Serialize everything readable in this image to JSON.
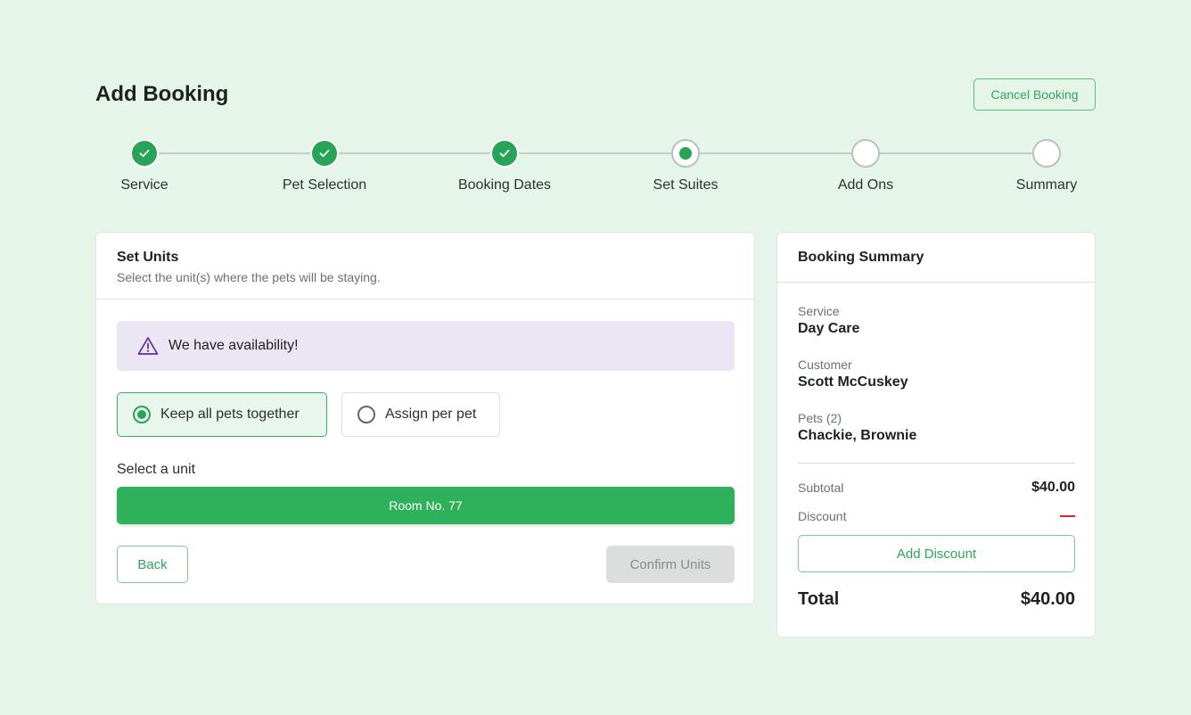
{
  "header": {
    "title": "Add Booking",
    "cancel_label": "Cancel Booking"
  },
  "stepper": {
    "steps": [
      {
        "label": "Service",
        "state": "done"
      },
      {
        "label": "Pet Selection",
        "state": "done"
      },
      {
        "label": "Booking Dates",
        "state": "done"
      },
      {
        "label": "Set Suites",
        "state": "current"
      },
      {
        "label": "Add Ons",
        "state": "todo"
      },
      {
        "label": "Summary",
        "state": "todo"
      }
    ]
  },
  "units_card": {
    "title": "Set Units",
    "subtitle": "Select the unit(s) where the pets will be staying.",
    "alert_text": "We have availability!",
    "options": [
      {
        "label": "Keep all pets together",
        "selected": true
      },
      {
        "label": "Assign per pet",
        "selected": false
      }
    ],
    "select_label": "Select a unit",
    "selected_unit": "Room No. 77",
    "back_label": "Back",
    "confirm_label": "Confirm Units"
  },
  "summary_card": {
    "title": "Booking Summary",
    "service_label": "Service",
    "service_value": "Day Care",
    "customer_label": "Customer",
    "customer_value": "Scott McCuskey",
    "pets_label": "Pets (2)",
    "pets_value": "Chackie, Brownie",
    "subtotal_label": "Subtotal",
    "subtotal_value": "$40.00",
    "discount_label": "Discount",
    "add_discount_label": "Add Discount",
    "total_label": "Total",
    "total_value": "$40.00"
  },
  "colors": {
    "background": "#e6f5ea",
    "accent": "#2fb15c",
    "alert_bg": "#ece6f4",
    "alert_icon": "#5b2d9e",
    "discount_dash": "#e02424"
  },
  "icons": {
    "done_step": "check-icon",
    "alert": "warning-triangle-icon"
  }
}
